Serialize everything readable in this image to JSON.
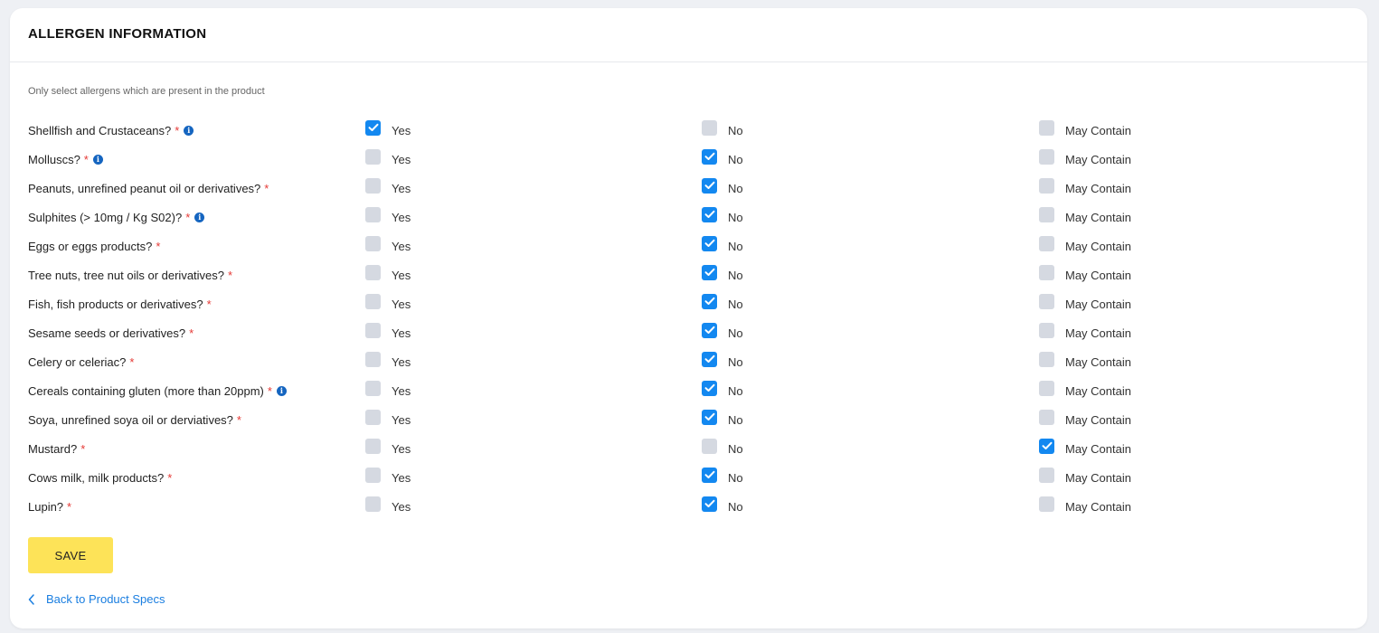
{
  "header": {
    "title": "ALLERGEN INFORMATION"
  },
  "hint": "Only select allergens which are present in the product",
  "option_labels": {
    "yes": "Yes",
    "no": "No",
    "may": "May Contain"
  },
  "required_mark": "*",
  "allergens": [
    {
      "label": "Shellfish and Crustaceans?",
      "info": true,
      "selected": "yes"
    },
    {
      "label": "Molluscs?",
      "info": true,
      "selected": "no"
    },
    {
      "label": "Peanuts, unrefined peanut oil or derivatives?",
      "info": false,
      "selected": "no"
    },
    {
      "label": "Sulphites (> 10mg / Kg S02)?",
      "info": true,
      "selected": "no"
    },
    {
      "label": "Eggs or eggs products?",
      "info": false,
      "selected": "no"
    },
    {
      "label": "Tree nuts, tree nut oils or derivatives?",
      "info": false,
      "selected": "no"
    },
    {
      "label": "Fish, fish products or derivatives?",
      "info": false,
      "selected": "no"
    },
    {
      "label": "Sesame seeds or derivatives?",
      "info": false,
      "selected": "no"
    },
    {
      "label": "Celery or celeriac?",
      "info": false,
      "selected": "no"
    },
    {
      "label": "Cereals containing gluten (more than 20ppm)",
      "info": true,
      "selected": "no"
    },
    {
      "label": "Soya, unrefined soya oil or derviatives?",
      "info": false,
      "selected": "no"
    },
    {
      "label": "Mustard?",
      "info": false,
      "selected": "may"
    },
    {
      "label": "Cows milk, milk products?",
      "info": false,
      "selected": "no"
    },
    {
      "label": "Lupin?",
      "info": false,
      "selected": "no"
    }
  ],
  "save_label": "SAVE",
  "back_link": {
    "label": "Back to Product Specs",
    "icon": "chevron-left-icon"
  },
  "colors": {
    "checkbox_checked": "#1388f0",
    "checkbox_unchecked": "#d5d9e1",
    "save_button": "#fde358",
    "link": "#1a7ee0",
    "required": "#e53935"
  }
}
